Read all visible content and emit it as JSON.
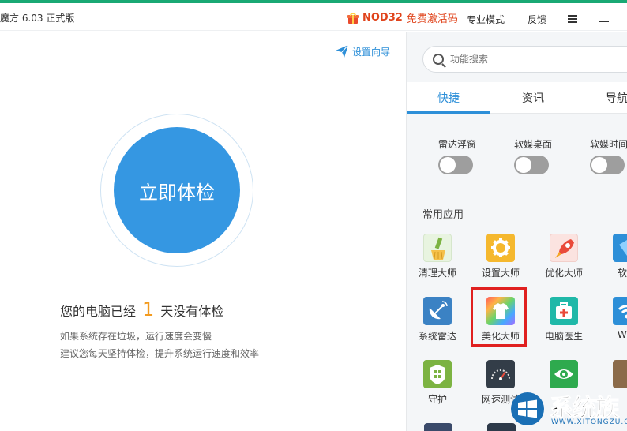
{
  "titlebar": {
    "app_title": "魔方 6.03 正式版",
    "nod_brand": "NOD32",
    "nod_offer": "免费激活码",
    "pro_mode": "专业模式",
    "feedback": "反馈"
  },
  "left": {
    "wizard": "设置向导",
    "check_button": "立即体检",
    "status_prefix": "您的电脑已经",
    "status_days": "1",
    "status_suffix": "天没有体检",
    "tip1": "如果系统存在垃圾，运行速度会变慢",
    "tip2": "建议您每天坚持体检，提升系统运行速度和效率"
  },
  "right": {
    "search_placeholder": "功能搜索",
    "tabs": [
      {
        "label": "快捷",
        "active": true
      },
      {
        "label": "资讯",
        "active": false
      },
      {
        "label": "导航",
        "active": false
      }
    ],
    "toggles": [
      {
        "label": "雷达浮窗",
        "on": false
      },
      {
        "label": "软媒桌面",
        "on": false
      },
      {
        "label": "软媒时间",
        "on": false
      }
    ],
    "apps_title": "常用应用",
    "apps": [
      {
        "label": "清理大师",
        "icon": "broom-icon",
        "color": "#e8f4e0"
      },
      {
        "label": "设置大师",
        "icon": "gear-icon",
        "color": "#f5b82e"
      },
      {
        "label": "优化大师",
        "icon": "rocket-icon",
        "color": "#fbe3e0"
      },
      {
        "label": "软件",
        "icon": "software-icon",
        "color": "#2d8fd8"
      },
      {
        "label": "系统雷达",
        "icon": "satellite-dish-icon",
        "color": "#3b82c4"
      },
      {
        "label": "美化大师",
        "icon": "tshirt-icon",
        "color": "#7a4fd0"
      },
      {
        "label": "电脑医生",
        "icon": "medical-kit-icon",
        "color": "#1fb8a8"
      },
      {
        "label": "WiFi",
        "icon": "wifi-icon",
        "color": "#2d8fd8"
      },
      {
        "label": "守护",
        "icon": "shield-grid-icon",
        "color": "#7cb342"
      },
      {
        "label": "网速测试",
        "icon": "speedometer-icon",
        "color": "#333d48"
      },
      {
        "label": "",
        "icon": "eye-icon",
        "color": "#2eaa4e"
      },
      {
        "label": "",
        "icon": "app-icon-brown",
        "color": "#8b6b4a"
      }
    ]
  },
  "watermark": {
    "text": "系统族",
    "url": "WWW.XITONGZU.COM"
  }
}
